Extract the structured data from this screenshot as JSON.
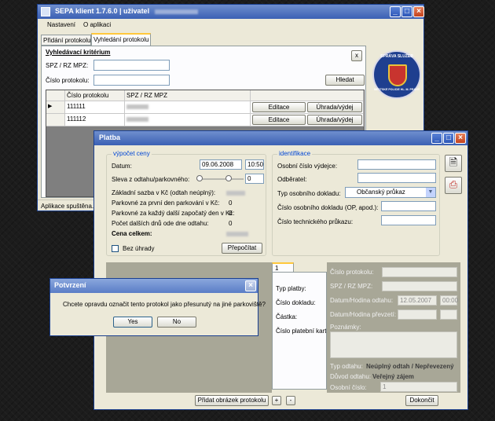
{
  "main_window": {
    "title_prefix": "SEPA klient 1.7.6.0 | uživatel",
    "menu": [
      "Nastavení",
      "O aplikaci"
    ],
    "tabs": [
      "Přidání protokolu",
      "Vyhledání protokolu"
    ],
    "search_header": "Vyhledávací kritérium",
    "spz_label": "SPZ / RZ MPZ:",
    "protocol_label": "Číslo protokolu:",
    "search_button": "Hledat",
    "close_button": "x",
    "grid_headers": [
      "Číslo protokolu",
      "SPZ / RZ MPZ"
    ],
    "rows": [
      {
        "number": "111111",
        "edit": "Editace",
        "pay": "Úhrada/výdej"
      },
      {
        "number": "111112",
        "edit": "Editace",
        "pay": "Úhrada/výdej"
      }
    ],
    "status": "Aplikace spuštěna.",
    "logo_top": "SPRÁVA SLUŽEB",
    "logo_bottom": "MĚSTSKÉ POLICIE HL. M. PRAHY"
  },
  "platba": {
    "title": "Platba",
    "vypocet": {
      "title": "výpočet ceny",
      "datum_label": "Datum:",
      "datum_value": "09.06.2008",
      "time_value": "10:50",
      "sleva_label": "Sleva z odtahu/parkovného:",
      "sleva_value": "0",
      "zakladni_label": "Základní sazba v Kč (odtah neúplný):",
      "prvni_den_label": "Parkovné za první den parkování v Kč:",
      "prvni_den_value": "0",
      "dalsi_den_label": "Parkovné za každý další započatý den v Kč:",
      "dalsi_den_value": "0",
      "pocet_label": "Počet dalších dnů ode dne odtahu:",
      "pocet_value": "0",
      "celkem_label": "Cena celkem:",
      "bez_uhrady_label": "Bez úhrady",
      "prepocitat_button": "Přepočítat"
    },
    "identifikace": {
      "title": "identifikace",
      "osobni_label": "Osobní číslo výdejce:",
      "odberatel_label": "Odběratel:",
      "typ_label": "Typ osobního dokladu:",
      "typ_value": "Občanský průkaz",
      "cislo_dokladu_label": "Číslo osobního dokladu (OP, apod.):",
      "tp_label": "Číslo technického průkazu:"
    },
    "lower_tab": "1",
    "lower_left": [
      "Typ platby:",
      "Číslo dokladu:",
      "Částka:",
      "Číslo platební karty:"
    ],
    "right_panel": {
      "cislo_protokolu_label": "Číslo protokolu:",
      "spz_label": "SPZ / RZ MPZ:",
      "odtah_label": "Datum/Hodina odtahu:",
      "odtah_date": "12.05.2007",
      "odtah_time": "00:00",
      "prevzeti_label": "Datum/Hodina převzetí:",
      "poznamky_label": "Poznámky:",
      "typ_odtahu_label": "Typ odtahu:",
      "typ_odtahu_value": "Neúplný odtah / Nepřevezený",
      "duvod_label": "Důvod odtahu:",
      "duvod_value": "Veřejný zájem",
      "osobni_label": "Osobní číslo:",
      "osobni_value": "1"
    },
    "pridat_button": "Přidat obrázek protokolu",
    "plus_button": "+",
    "minus_button": "-",
    "dokoncit_button": "Dokončit"
  },
  "dialog": {
    "title": "Potvrzení",
    "message": "Chcete opravdu označit tento protokol jako přesunutý na jiné parkoviště?",
    "yes": "Yes",
    "no": "No"
  },
  "colors": {
    "title_blue": "#3b60b4",
    "close_red": "#c2421e",
    "group_title": "#0046d5"
  }
}
